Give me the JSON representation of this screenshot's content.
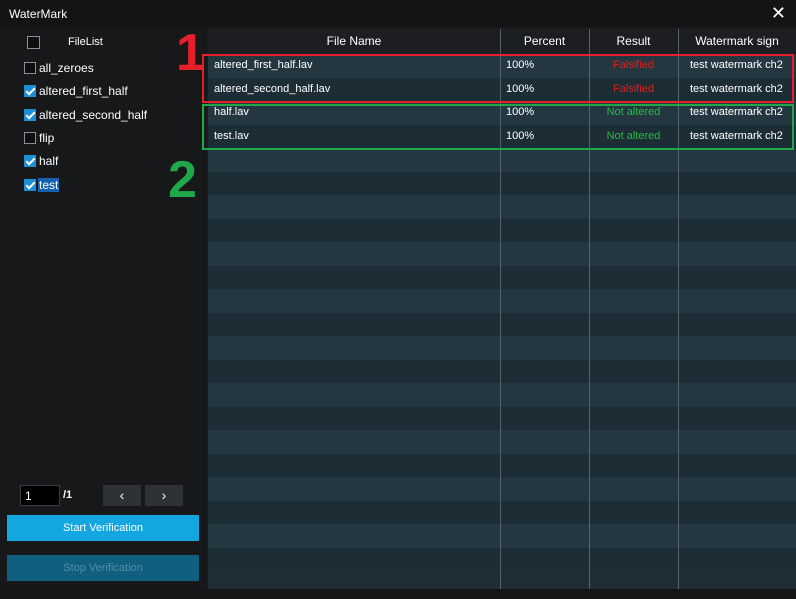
{
  "window": {
    "title": "WaterMark",
    "close_glyph": "✕"
  },
  "sidebar": {
    "header_title": "FileList",
    "header_checked": false,
    "files": [
      {
        "name": "all_zeroes",
        "checked": false,
        "selected": false
      },
      {
        "name": "altered_first_half",
        "checked": true,
        "selected": false
      },
      {
        "name": "altered_second_half",
        "checked": true,
        "selected": false
      },
      {
        "name": "flip",
        "checked": false,
        "selected": false
      },
      {
        "name": "half",
        "checked": true,
        "selected": false
      },
      {
        "name": "test",
        "checked": true,
        "selected": true
      }
    ],
    "pagination": {
      "current_page": "1",
      "total_label": "/1",
      "prev_glyph": "‹",
      "next_glyph": "›"
    },
    "start_label": "Start Verification",
    "stop_label": "Stop Verification"
  },
  "table": {
    "columns": [
      "File Name",
      "Percent",
      "Result",
      "Watermark sign"
    ],
    "rows": [
      {
        "file": "altered_first_half.lav",
        "percent": "100%",
        "result": "Falsified",
        "status": "falsified",
        "sign": "test watermark ch2"
      },
      {
        "file": "altered_second_half.lav",
        "percent": "100%",
        "result": "Falsified",
        "status": "falsified",
        "sign": "test watermark ch2"
      },
      {
        "file": "half.lav",
        "percent": "100%",
        "result": "Not altered",
        "status": "ok",
        "sign": "test watermark ch2"
      },
      {
        "file": "test.lav",
        "percent": "100%",
        "result": "Not altered",
        "status": "ok",
        "sign": "test watermark ch2"
      }
    ],
    "empty_rows": 18
  },
  "annotations": [
    {
      "label": "1",
      "color": "#e5202b"
    },
    {
      "label": "2",
      "color": "#1ea84a"
    }
  ],
  "colors": {
    "falsified": "#d8201e",
    "ok": "#1fbf3f",
    "accent": "#14a6e0"
  }
}
